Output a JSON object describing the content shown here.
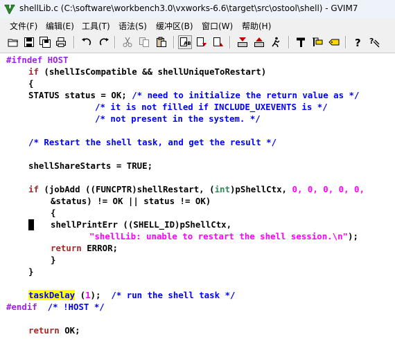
{
  "window": {
    "title": "shellLib.c (C:\\software\\workbench3.0\\vxworks-6.6\\target\\src\\ostool\\shell) - GVIM7"
  },
  "menu": [
    "文件(F)",
    "编辑(E)",
    "工具(T)",
    "语法(S)",
    "缓冲区(B)",
    "窗口(W)",
    "帮助(H)"
  ],
  "code": {
    "l1_pre": "#ifndef HOST",
    "l2_a": "if",
    "l2_b": " (shellIsCompatible && shellUniqueToRestart)",
    "l3": "{",
    "l4_a": "STATUS status = OK; ",
    "l4_b": "/* need to initialize the return value as */",
    "l5": "/* it is not filled if INCLUDE_UXEVENTS is */",
    "l6": "/* not present in the system. */",
    "l8": "/* Restart the shell task, and get the result */",
    "l10": "shellShareStarts = TRUE;",
    "l12_a": "if",
    "l12_b": " (jobAdd ((FUNCPTR)shellRestart, (",
    "l12_c": "int",
    "l12_d": ")pShellCtx, ",
    "l12_nums": "0, 0, 0, 0, 0,",
    "l13": "&status) != OK || status != OK)",
    "l14": "{",
    "l15": "shellPrintErr ((SHELL_ID)pShellCtx,",
    "l16_str": "\"shellLib: unable to restart the shell session.\\n\"",
    "l16_end": ");",
    "l17_kw": "return",
    "l17_rest": " ERROR;",
    "l18": "}",
    "l19": "}",
    "l21_todo": "taskDelay",
    "l21_a": " (",
    "l21_num": "1",
    "l21_b": ");  ",
    "l21_com": "/* run the shell task */",
    "l22_pre": "#endif",
    "l22_com": "  /* !HOST */",
    "l24_kw": "return",
    "l24_rest": " OK;"
  }
}
